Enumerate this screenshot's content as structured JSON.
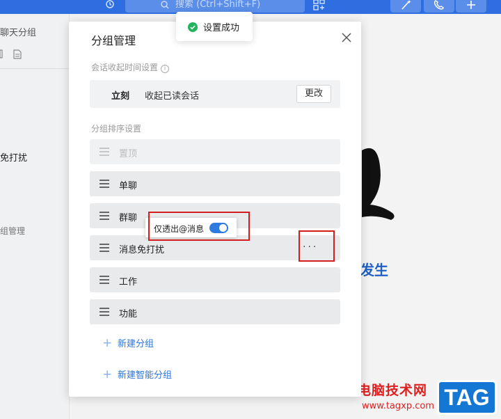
{
  "topbar": {
    "search_placeholder": "搜索 (Ctrl+Shift+F)",
    "history_icon": "history-icon",
    "search_icon": "search-icon",
    "apps_icon": "apps-grid-icon",
    "buttons": [
      "magic-wand-icon",
      "phone-icon",
      "plus-icon"
    ],
    "accent": "#2e6ee0"
  },
  "left_pane": {
    "title": "聊天分组",
    "item_dnd": "免打扰",
    "item_manage": "组管理"
  },
  "right_pane": {
    "occur_text": "发生",
    "watermark": "电脑技术网",
    "watermark_url": "www.tagxp.com",
    "tag_logo": "TAG"
  },
  "toast": {
    "text": "设置成功",
    "icon": "check-circle-icon",
    "color": "#22b35e"
  },
  "dialog": {
    "title": "分组管理",
    "collapse_section_label": "会话收起时间设置",
    "collapse_when": "立刻",
    "collapse_desc": "收起已读会话",
    "change_button": "更改",
    "sort_section_label": "分组排序设置",
    "groups": [
      {
        "label": "置顶",
        "disabled": true
      },
      {
        "label": "单聊",
        "disabled": false
      },
      {
        "label": "群聊",
        "disabled": false
      },
      {
        "label": "消息免打扰",
        "disabled": false
      },
      {
        "label": "工作",
        "disabled": false
      },
      {
        "label": "功能",
        "disabled": false
      }
    ],
    "more_glyph": "···",
    "new_group": "新建分组",
    "new_smart_group": "新建智能分组"
  },
  "popup": {
    "label": "仅透出@消息",
    "toggle_on": true
  }
}
